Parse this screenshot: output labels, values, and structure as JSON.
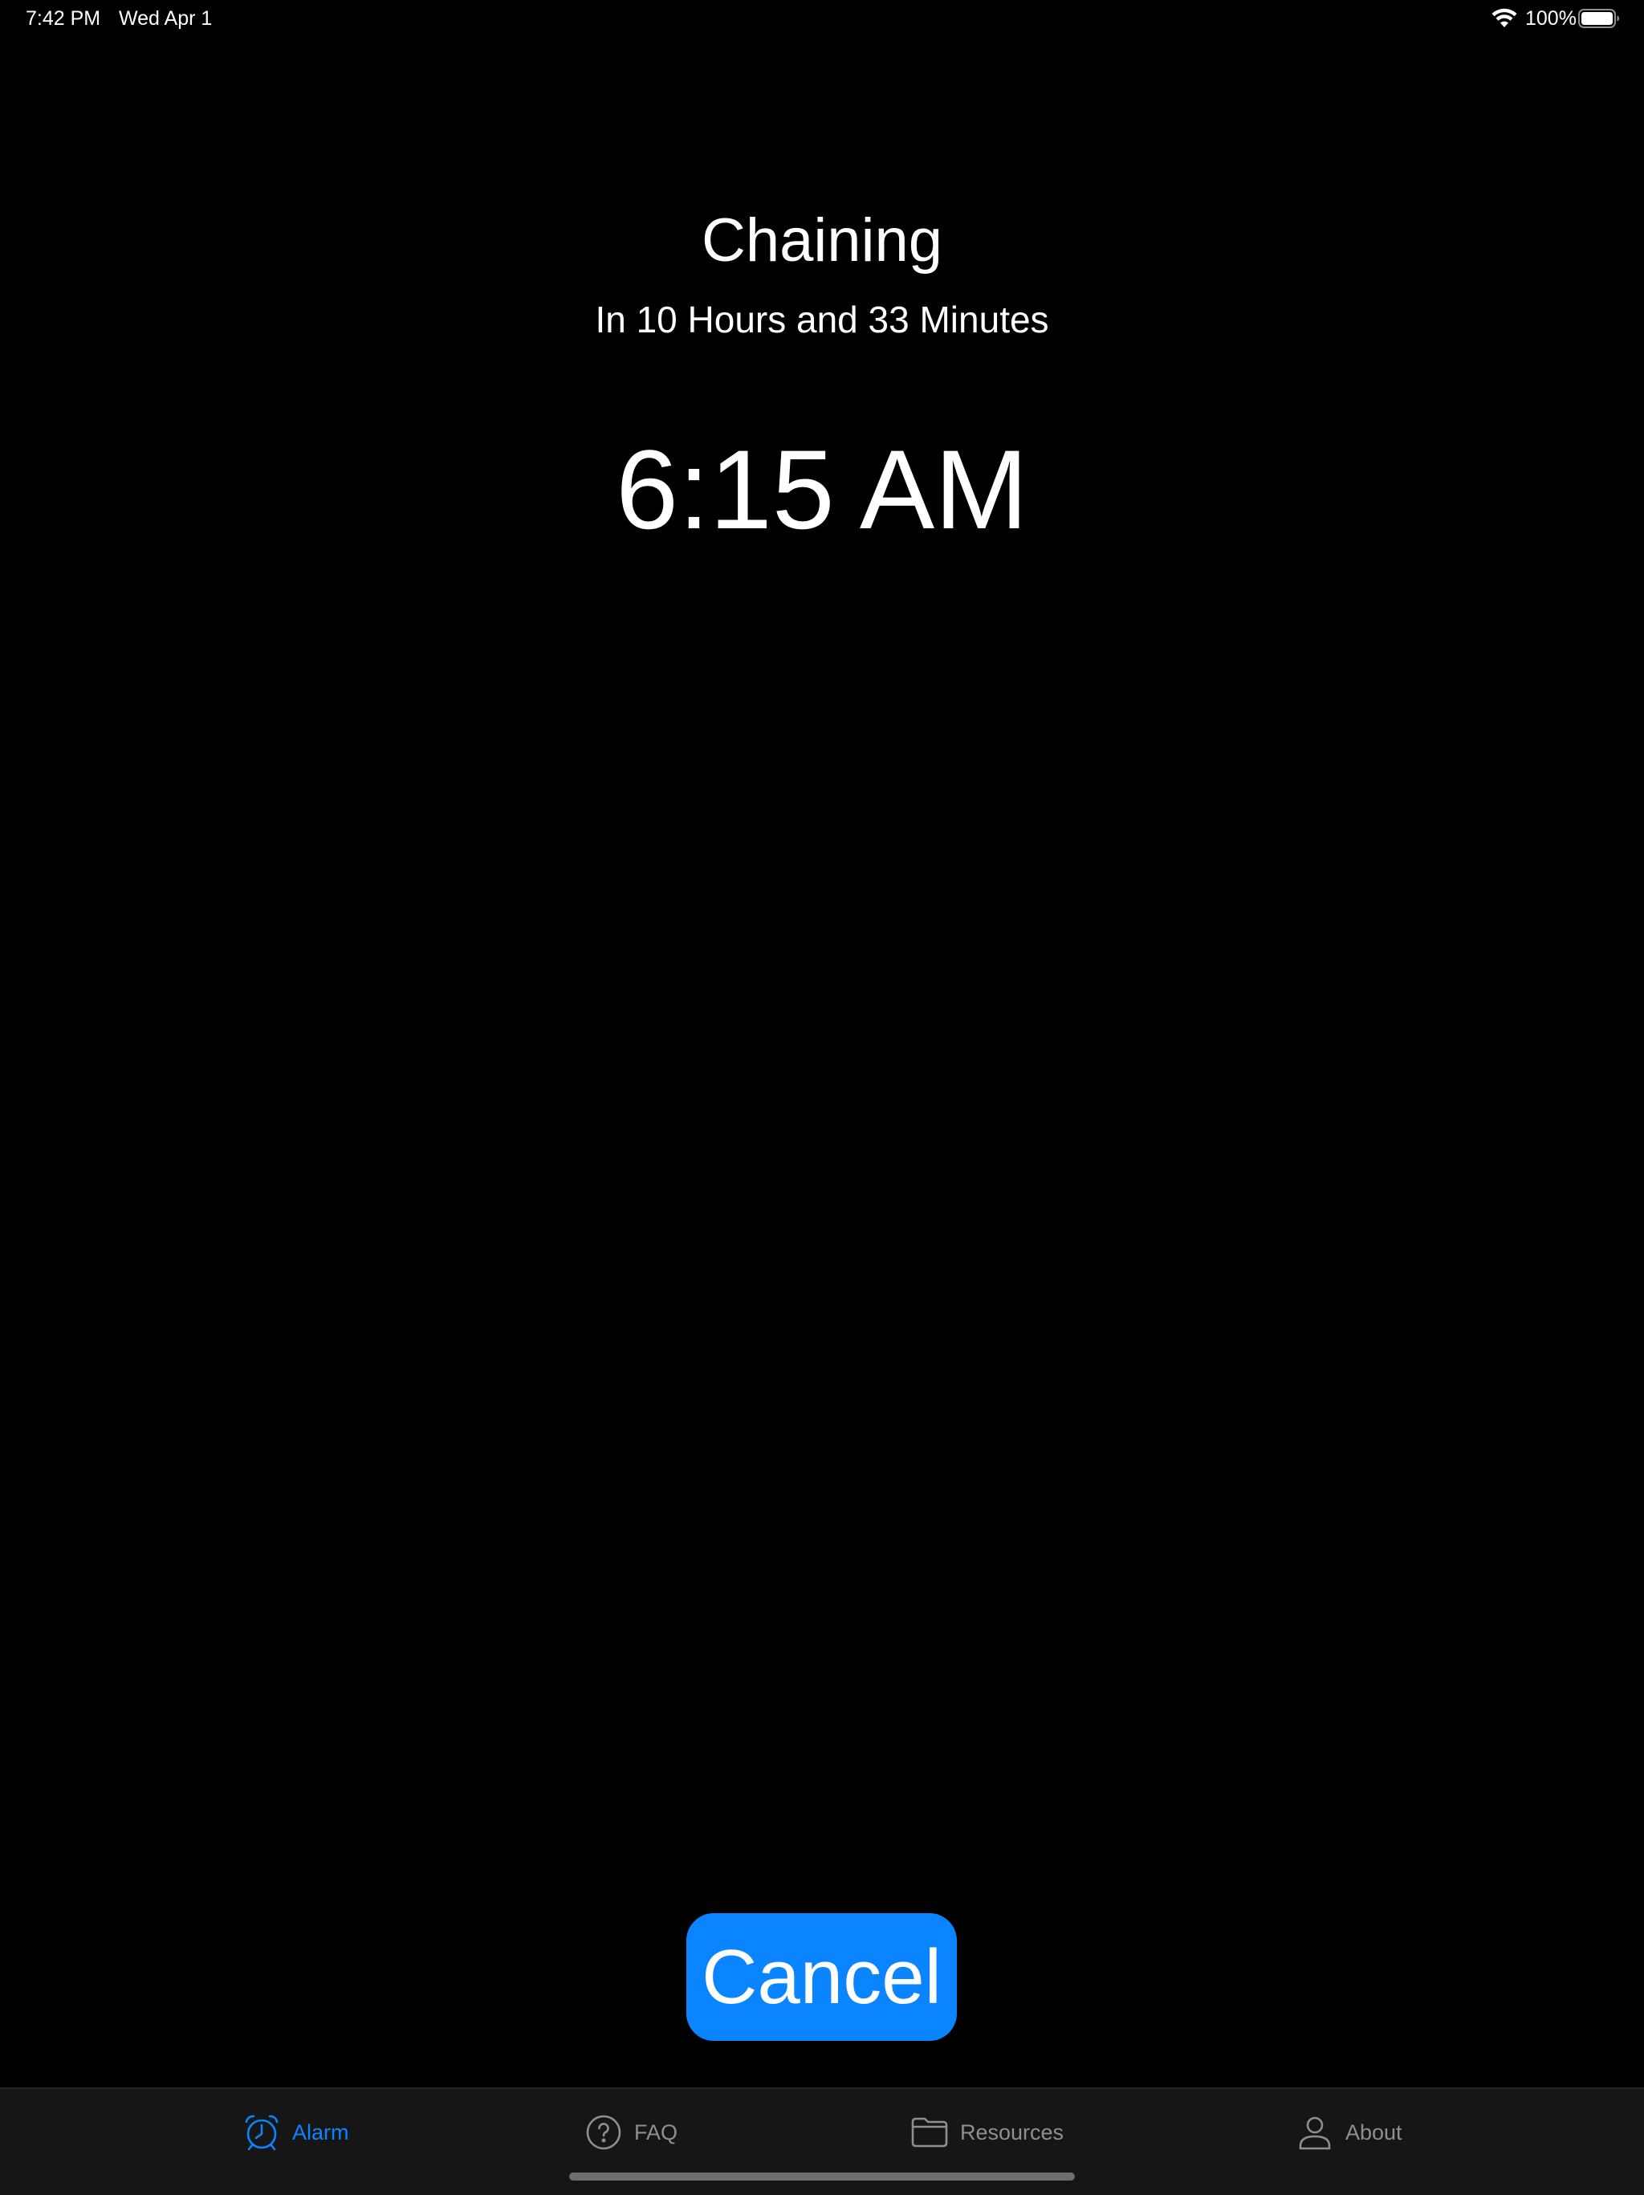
{
  "status_bar": {
    "time": "7:42 PM",
    "date": "Wed Apr 1",
    "battery": "100%"
  },
  "alarm": {
    "title": "Chaining",
    "countdown": "In 10 Hours and 33 Minutes",
    "time": "6:15 AM"
  },
  "cancel_label": "Cancel",
  "tabs": [
    {
      "label": "Alarm",
      "icon": "alarm-clock-icon",
      "active": true
    },
    {
      "label": "FAQ",
      "icon": "question-circle-icon",
      "active": false
    },
    {
      "label": "Resources",
      "icon": "folder-icon",
      "active": false
    },
    {
      "label": "About",
      "icon": "person-icon",
      "active": false
    }
  ],
  "colors": {
    "accent": "#0a84ff",
    "background": "#000000",
    "tab_bar": "#161616",
    "inactive": "#8e8e93"
  }
}
